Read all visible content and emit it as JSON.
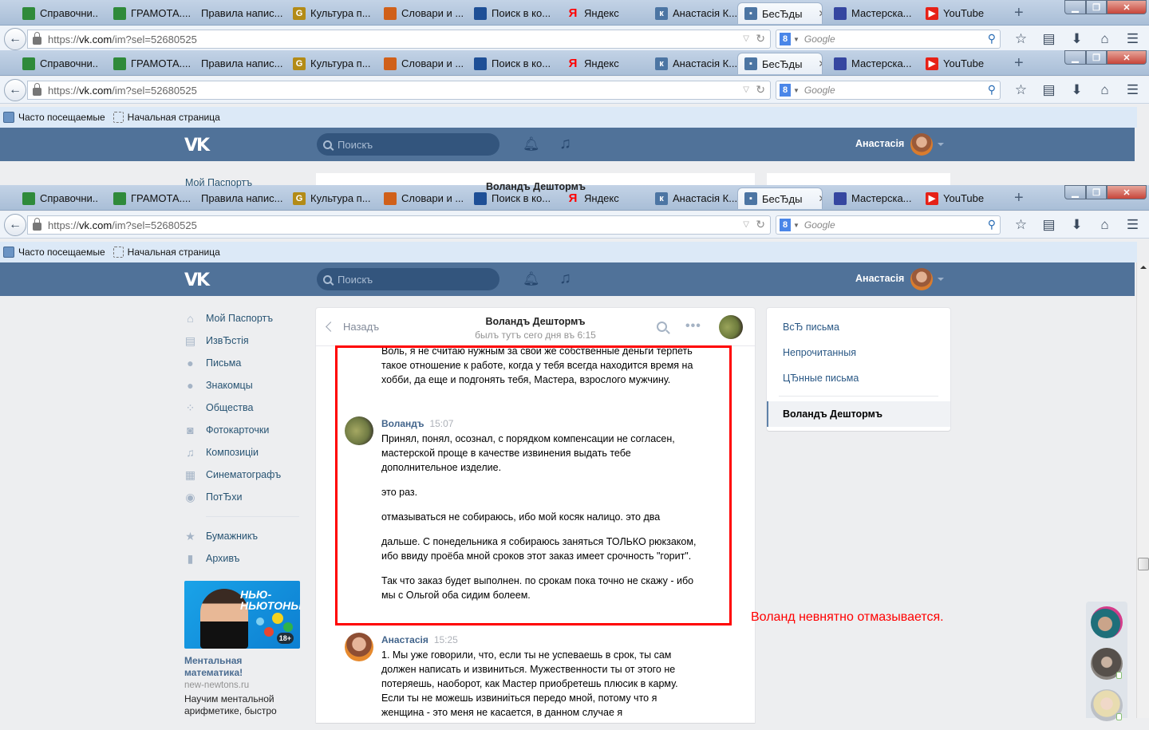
{
  "browser": {
    "tabs": [
      {
        "label": "Справочни...",
        "icon": "gramota-icon",
        "color": "#2f8a3a"
      },
      {
        "label": "ГРАМОТА....",
        "icon": "gramota-icon",
        "color": "#2f8a3a"
      },
      {
        "label": "Правила напис...",
        "icon": "",
        "color": ""
      },
      {
        "label": "Культура п...",
        "icon": "g-letter-icon",
        "color": "#b38b16"
      },
      {
        "label": "Словари и ...",
        "icon": "books-icon",
        "color": "#d0601a"
      },
      {
        "label": "Поиск в ко...",
        "icon": "corpus-icon",
        "color": "#1e4f96"
      },
      {
        "label": "Яндекс",
        "icon": "yandex-icon",
        "color": "#ff0000"
      },
      {
        "label": "Анастасія К...",
        "icon": "vk-icon",
        "color": "#4c75a3"
      },
      {
        "label": "БесЂды",
        "icon": "vk-messages-icon",
        "color": "#4c75a3",
        "active": true
      },
      {
        "label": "Мастерска...",
        "icon": "climber-icon",
        "color": "#3546a0"
      },
      {
        "label": "YouTube",
        "icon": "youtube-icon",
        "color": "#e62117"
      }
    ],
    "new_tab": "+",
    "url_prefix": "https://",
    "url_domain": "vk.com",
    "url_path": "/im?sel=52680525",
    "search_engine": "Google",
    "search_placeholder": "Google",
    "bookmarks": [
      "Часто посещаемые",
      "Начальная страница"
    ]
  },
  "vk_header": {
    "logo": "VK",
    "search_placeholder": "Поискъ",
    "user_name": "Анастасія"
  },
  "left_menu": {
    "items": [
      {
        "label": "Мой Паспортъ",
        "icon": "home-icon"
      },
      {
        "label": "ИзвЂстія",
        "icon": "news-icon"
      },
      {
        "label": "Письма",
        "icon": "messages-icon"
      },
      {
        "label": "Знакомцы",
        "icon": "friends-icon"
      },
      {
        "label": "Общества",
        "icon": "groups-icon"
      },
      {
        "label": "Фотокарточки",
        "icon": "camera-icon"
      },
      {
        "label": "Композиціи",
        "icon": "music-icon"
      },
      {
        "label": "Синематографъ",
        "icon": "film-icon"
      },
      {
        "label": "ПотЂхи",
        "icon": "gamepad-icon"
      }
    ],
    "extra_items": [
      {
        "label": "Бумажникъ",
        "icon": "star-icon"
      },
      {
        "label": "Архивъ",
        "icon": "document-icon"
      }
    ]
  },
  "ad": {
    "brand": "НЬЮ-НЬЮТОНЫ",
    "age": "18+",
    "title": "Ментальная математика!",
    "domain": "new-newtons.ru",
    "description": "Научим ментальной арифметике, быстро"
  },
  "chat": {
    "back_label": "Назадъ",
    "peer_name": "Воландъ Дештормъ",
    "peer_status": "былъ тутъ сего дня въ 6:15",
    "messages": [
      {
        "author": "",
        "time": "",
        "paragraphs": [
          "Воль, я не считаю нужным за свои же собственные деньги терпеть такое отношение к работе, когда у тебя всегда находится время на хобби, да еще и подгонять тебя, Мастера, взрослого мужчину."
        ]
      },
      {
        "author": "Воландъ",
        "time": "15:07",
        "paragraphs": [
          "Принял, понял, осознал, с порядком компенсации не согласен, мастерской проще в качестве извинения выдать тебе дополнительное изделие.",
          "это раз.",
          "отмазываться не собираюсь, ибо мой косяк налицо. это два",
          "дальше. С понедельника я собираюсь заняться ТОЛЬКО рюкзаком, ибо ввиду проёба мной сроков этот заказ имеет срочность \"горит\".",
          "Так что заказ будет выполнен. по срокам пока точно не скажу - ибо мы с Ольгой оба сидим болеем."
        ]
      },
      {
        "author": "Анастасія",
        "time": "15:25",
        "paragraphs": [
          "1. Мы уже говорили, что, если ты не успеваешь в срок, ты сам должен написать и извиниться. Мужественности ты от этого не потеряешь, наоборот, как Мастер приобретешь плюсик в карму. Если ты не можешь извиниiться передо мной, потому что я женщина - это меня не касается, в данном случае я"
        ]
      }
    ]
  },
  "right_menu": {
    "items": [
      "ВсЂ письма",
      "Непрочитанныя",
      "ЦЂнные письма"
    ],
    "selected": "Воландъ Дештормъ"
  },
  "annotation": "Воланд невнятно отмазывается.",
  "colors": {
    "vk_blue": "#507299",
    "link": "#2a5885",
    "highlight_red": "#ff0000"
  }
}
